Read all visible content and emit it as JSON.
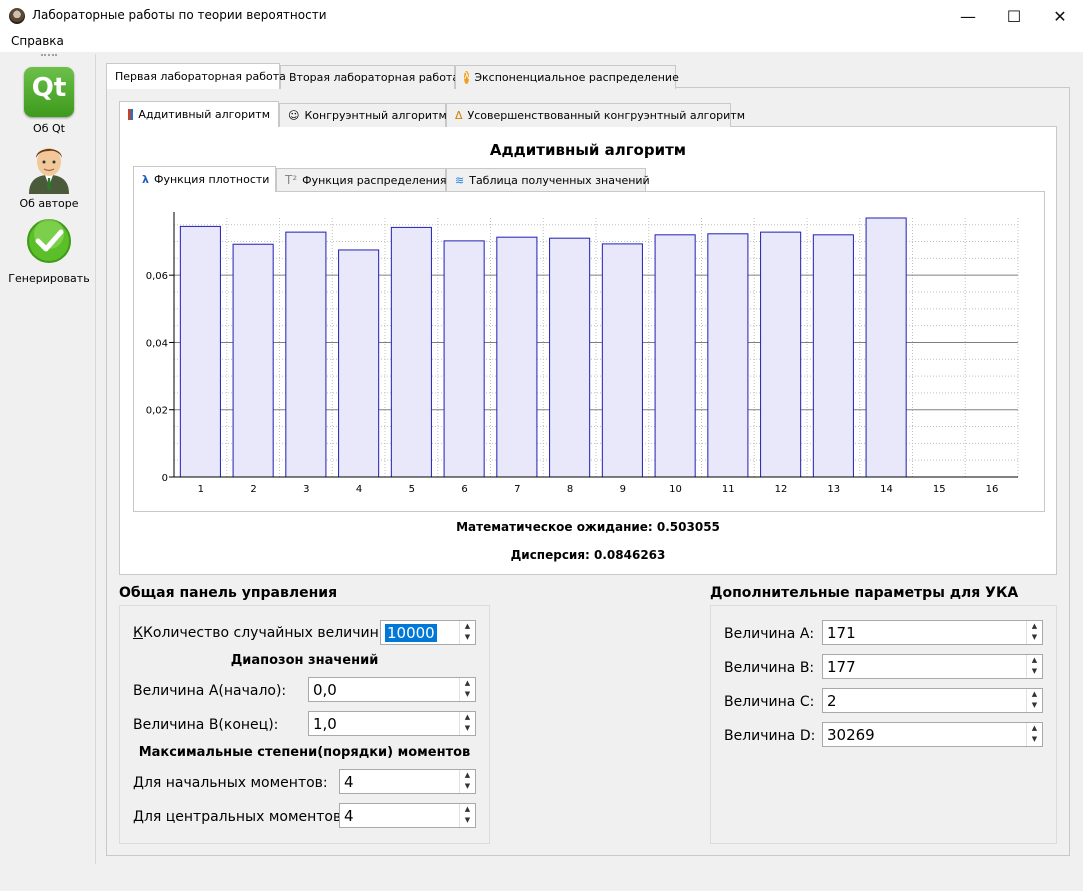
{
  "window": {
    "title": "Лабораторные работы по теории вероятности",
    "minimize": "—",
    "maximize": "☐",
    "close": "✕"
  },
  "menu": {
    "help": "Справка"
  },
  "toolbar": {
    "about_qt": "Об Qt",
    "about_author": "Об авторе",
    "generate": "Генерировать",
    "qt_logo_text": "Qt"
  },
  "tabs_main": [
    "Первая лабораторная работа",
    "Вторая лабораторная работа",
    "Экспоненциальное распределение"
  ],
  "tabs_algo": [
    "Аддитивный алгоритм",
    "Конгруэнтный алгоритм",
    "Усовершенствованный конгруэнтный алгоритм"
  ],
  "algo_title": "Аддитивный алгоритм",
  "tabs_func": [
    "Функция плотности",
    "Функция распределения",
    "Таблица полученных значений"
  ],
  "stats": {
    "mean": "Математическое ожидание: 0.503055",
    "variance": "Дисперсия: 0.0846263"
  },
  "control_panel": {
    "title": "Общая панель управления",
    "count_label": "Количество случайных величин:",
    "count_value": "10000",
    "range_title": "Диапозон значений",
    "a_label": "Величина А(начало):",
    "a_value": "0,0",
    "b_label": "Величина В(конец):",
    "b_value": "1,0",
    "moments_title": "Максимальные степени(порядки) моментов",
    "initial_label": "Для начальных моментов:",
    "initial_value": "4",
    "central_label": "Для центральных моментов:",
    "central_value": "4"
  },
  "uka_panel": {
    "title": "Дополнительные параметры для УКА",
    "a_label": "Величина А:",
    "a_value": "171",
    "b_label": "Величина В:",
    "b_value": "177",
    "c_label": "Величина С:",
    "c_value": "2",
    "d_label": "Величина D:",
    "d_value": "30269"
  },
  "chart_data": {
    "type": "bar",
    "categories": [
      "1",
      "2",
      "3",
      "4",
      "5",
      "6",
      "7",
      "8",
      "9",
      "10",
      "11",
      "12",
      "13",
      "14"
    ],
    "values": [
      0.0745,
      0.0692,
      0.0728,
      0.0675,
      0.0742,
      0.0702,
      0.0713,
      0.071,
      0.0693,
      0.072,
      0.0723,
      0.0728,
      0.072,
      0.077
    ],
    "xlim": [
      0,
      16
    ],
    "xticks": [
      "1",
      "2",
      "3",
      "4",
      "5",
      "6",
      "7",
      "8",
      "9",
      "10",
      "11",
      "12",
      "13",
      "14",
      "15",
      "16"
    ],
    "ylim": [
      0,
      0.077
    ],
    "yticks": [
      "0",
      "0,02",
      "0,04",
      "0,06"
    ],
    "ytick_values": [
      0,
      0.02,
      0.04,
      0.06
    ],
    "grid": true,
    "bar_color": "#e8e8fa",
    "bar_edge": "#1f1fb4"
  }
}
